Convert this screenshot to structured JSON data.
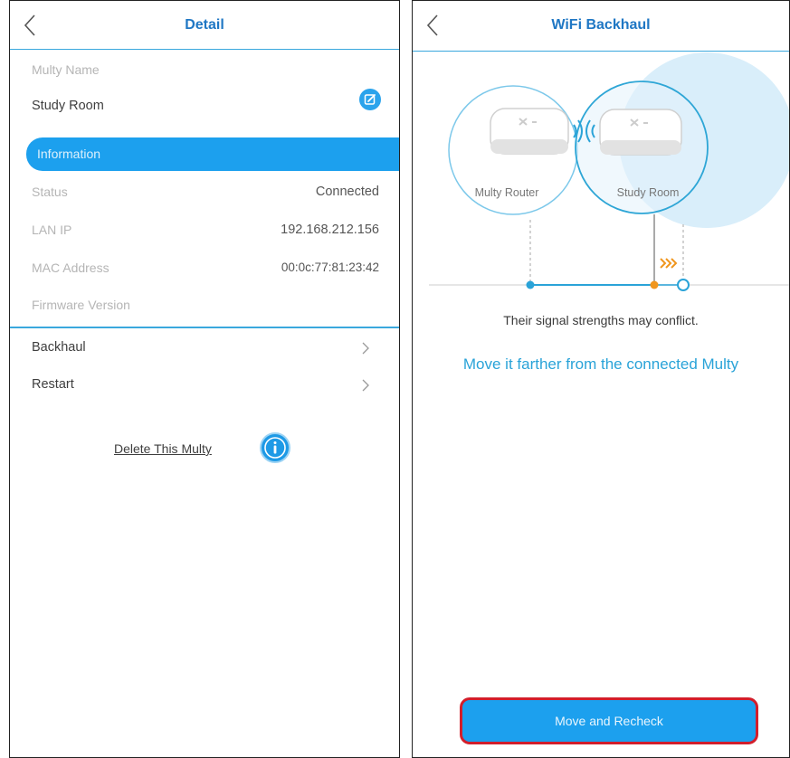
{
  "detail": {
    "title": "Detail",
    "multy_name_label": "Multy Name",
    "multy_name_value": "Study Room",
    "section_information": "Information",
    "info_rows": [
      {
        "label": "Status",
        "value": "Connected"
      },
      {
        "label": "LAN IP",
        "value": "192.168.212.156"
      },
      {
        "label": "MAC Address",
        "value": "00:0c:77:81:23:42"
      },
      {
        "label": "Firmware Version",
        "value": ""
      }
    ],
    "menu_items": [
      {
        "label": "Backhaul"
      },
      {
        "label": "Restart"
      }
    ],
    "delete_link": "Delete This Multy"
  },
  "backhaul": {
    "title": "WiFi Backhaul",
    "router_label": "Multy Router",
    "node_label": "Study Room",
    "signal_message": "Their signal strengths may conflict.",
    "advice": "Move it farther from the connected Multy",
    "recheck_button": "Move and Recheck"
  },
  "colors": {
    "accent_blue": "#1ca0ee",
    "title_blue": "#1f77c4",
    "orange": "#f0961e",
    "highlight_red": "#d21e2b"
  },
  "icons": [
    "back-arrow-icon",
    "edit-icon",
    "chevron-right-icon",
    "info-icon",
    "wifi-signal-icon"
  ]
}
